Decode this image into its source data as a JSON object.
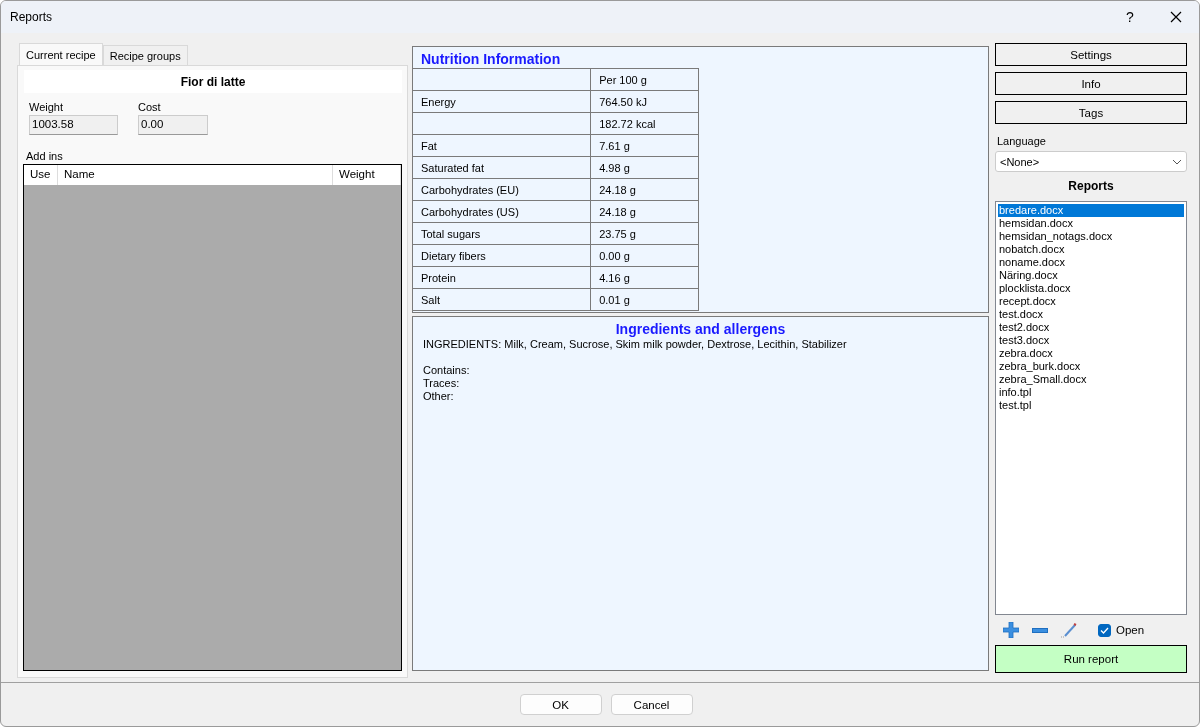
{
  "window": {
    "title": "Reports",
    "help": "?"
  },
  "tabs": [
    {
      "label": "Current recipe",
      "selected": true
    },
    {
      "label": "Recipe groups",
      "selected": false
    }
  ],
  "recipe": {
    "name": "Fior di latte",
    "weight_label": "Weight",
    "weight": "1003.58",
    "cost_label": "Cost",
    "cost": "0.00",
    "addins_label": "Add ins",
    "addins_columns": [
      "Use",
      "Name",
      "Weight"
    ]
  },
  "nutrition": {
    "title": "Nutrition Information",
    "header": "Per 100 g",
    "rows": [
      {
        "name": "Energy",
        "value": "764.50 kJ"
      },
      {
        "name": "",
        "value": "182.72 kcal"
      },
      {
        "name": "Fat",
        "value": "7.61 g"
      },
      {
        "name": "Saturated fat",
        "value": "4.98 g"
      },
      {
        "name": "Carbohydrates (EU)",
        "value": "24.18 g"
      },
      {
        "name": "Carbohydrates (US)",
        "value": "24.18 g"
      },
      {
        "name": "Total sugars",
        "value": "23.75 g"
      },
      {
        "name": "Dietary fibers",
        "value": "0.00 g"
      },
      {
        "name": "Protein",
        "value": "4.16 g"
      },
      {
        "name": "Salt",
        "value": "0.01 g"
      }
    ]
  },
  "ingredients": {
    "title": "Ingredients and allergens",
    "text": "INGREDIENTS: Milk, Cream, Sucrose, Skim milk powder, Dextrose, Lecithin, Stabilizer",
    "lines": [
      "Contains:",
      "Traces:",
      "Other:"
    ]
  },
  "side_buttons": [
    "Settings",
    "Info",
    "Tags"
  ],
  "language": {
    "label": "Language",
    "value": "<None>"
  },
  "reports": {
    "title": "Reports",
    "items": [
      {
        "label": "bredare.docx",
        "selected": true
      },
      {
        "label": "hemsidan.docx",
        "selected": false
      },
      {
        "label": "hemsidan_notags.docx",
        "selected": false
      },
      {
        "label": "nobatch.docx",
        "selected": false
      },
      {
        "label": "noname.docx",
        "selected": false
      },
      {
        "label": "Näring.docx",
        "selected": false
      },
      {
        "label": "plocklista.docx",
        "selected": false
      },
      {
        "label": "recept.docx",
        "selected": false
      },
      {
        "label": "test.docx",
        "selected": false
      },
      {
        "label": "test2.docx",
        "selected": false
      },
      {
        "label": "test3.docx",
        "selected": false
      },
      {
        "label": "zebra.docx",
        "selected": false
      },
      {
        "label": "zebra_burk.docx",
        "selected": false
      },
      {
        "label": "zebra_Small.docx",
        "selected": false
      },
      {
        "label": "info.tpl",
        "selected": false
      },
      {
        "label": "test.tpl",
        "selected": false
      }
    ]
  },
  "open": {
    "label": "Open",
    "checked": true
  },
  "run_button": "Run report",
  "footer_buttons": [
    "OK",
    "Cancel"
  ]
}
